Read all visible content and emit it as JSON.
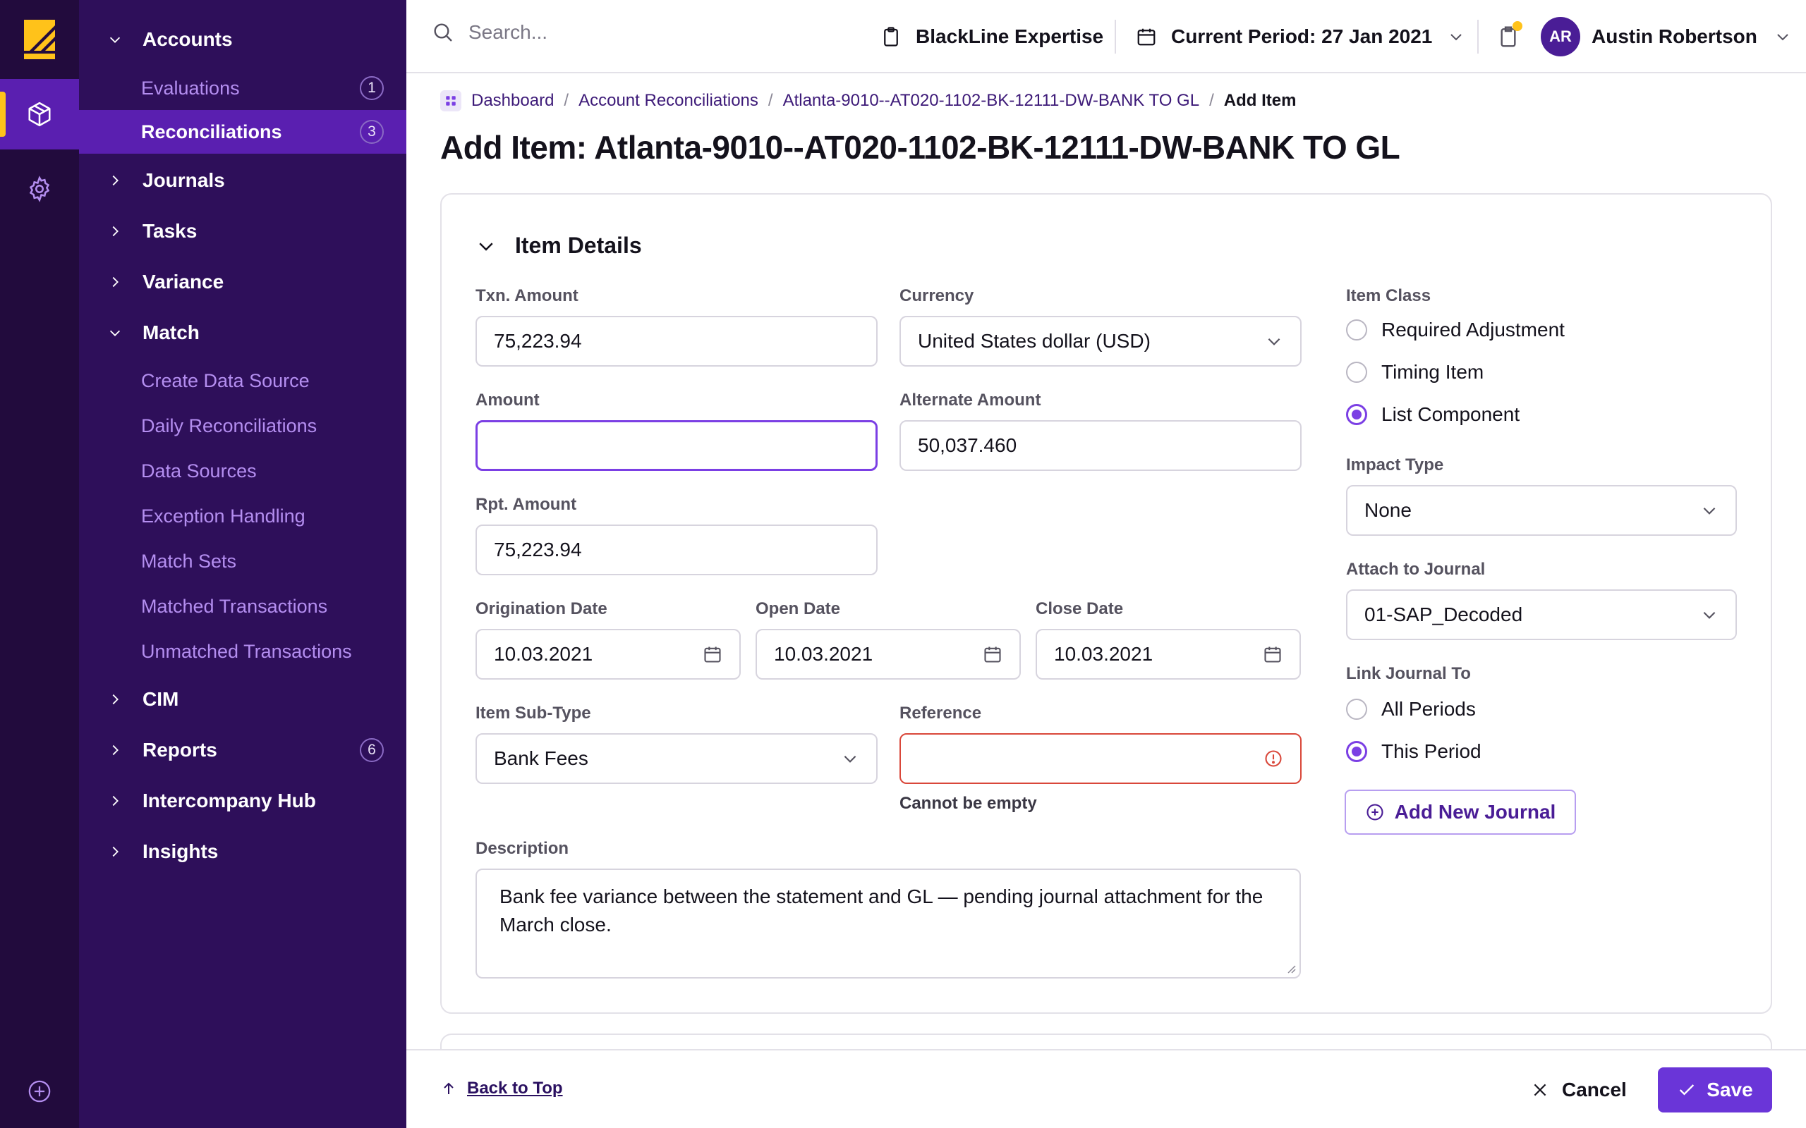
{
  "colors": {
    "rail_bg": "#220b3d",
    "nav_bg": "#2e0f5a",
    "active_bg": "#5a1fb0",
    "accent_yellow": "#ffc21a",
    "primary": "#6a35d8",
    "error": "#d9473a"
  },
  "rail": {
    "icons": [
      "logo-icon",
      "box-icon",
      "gear-icon",
      "plus-circle-icon"
    ]
  },
  "nav": {
    "accounts": "Accounts",
    "evaluations": "Evaluations",
    "evaluations_count": "1",
    "reconciliations": "Reconciliations",
    "reconciliations_count": "3",
    "journals": "Journals",
    "tasks": "Tasks",
    "variance": "Variance",
    "match": "Match",
    "match_items": [
      "Create Data Source",
      "Daily Reconciliations",
      "Data Sources",
      "Exception Handling",
      "Match Sets",
      "Matched Transactions",
      "Unmatched Transactions"
    ],
    "cim": "CIM",
    "reports": "Reports",
    "reports_count": "6",
    "intercompany": "Intercompany Hub",
    "insights": "Insights"
  },
  "topbar": {
    "search_placeholder": "Search...",
    "expertise": "BlackLine Expertise",
    "period": "Current Period: 27 Jan 2021",
    "avatar_initials": "AR",
    "user_name": "Austin Robertson"
  },
  "breadcrumb": {
    "items": [
      "Dashboard",
      "Account Reconciliations",
      "Atlanta-9010--AT020-1102-BK-12111-DW-BANK TO GL"
    ],
    "current": "Add Item"
  },
  "page": {
    "title": "Add Item: Atlanta-9010--AT020-1102-BK-12111-DW-BANK TO GL"
  },
  "form": {
    "section_title": "Item Details",
    "txn_amount_label": "Txn. Amount",
    "txn_amount": "75,223.94",
    "currency_label": "Currency",
    "currency": "United States dollar (USD)",
    "amount_label": "Amount",
    "amount": "",
    "alt_amount_label": "Alternate Amount",
    "alt_amount": "50,037.460",
    "rpt_amount_label": "Rpt. Amount",
    "rpt_amount": "75,223.94",
    "orig_date_label": "Origination Date",
    "orig_date": "10.03.2021",
    "open_date_label": "Open Date",
    "open_date": "10.03.2021",
    "close_date_label": "Close Date",
    "close_date": "10.03.2021",
    "subtype_label": "Item Sub-Type",
    "subtype": "Bank Fees",
    "reference_label": "Reference",
    "reference": "",
    "reference_error": "Cannot be empty",
    "description_label": "Description",
    "description": "Bank fee variance between the statement and GL — pending journal attachment for the March close.",
    "item_class_label": "Item Class",
    "item_class_options": [
      "Required Adjustment",
      "Timing Item",
      "List Component"
    ],
    "item_class_selected": "List Component",
    "impact_type_label": "Impact Type",
    "impact_type": "None",
    "attach_journal_label": "Attach to Journal",
    "attach_journal": "01-SAP_Decoded",
    "link_journal_label": "Link Journal To",
    "link_journal_options": [
      "All Periods",
      "This Period"
    ],
    "link_journal_selected": "This Period",
    "add_journal": "Add New Journal"
  },
  "footer": {
    "back_to_top": "Back to Top",
    "cancel": "Cancel",
    "save": "Save"
  }
}
